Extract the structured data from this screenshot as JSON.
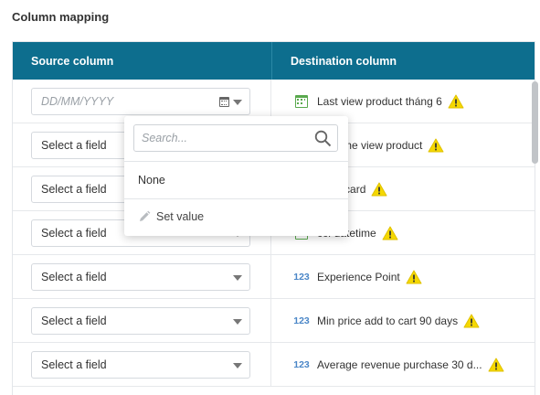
{
  "section_title": "Column mapping",
  "table": {
    "headers": {
      "source": "Source column",
      "destination": "Destination column"
    },
    "rows": [
      {
        "source_value": "DD/MM/YYYY",
        "source_kind": "date",
        "dest_type": "date",
        "dest_label": "Last view product tháng 6",
        "warning": true
      },
      {
        "source_value": "Select a field",
        "source_kind": "select",
        "dest_type": "date",
        "dest_label": "last time view product",
        "warning": true
      },
      {
        "source_value": "Select a field",
        "source_kind": "select",
        "dest_type": "date",
        "dest_label": "dd to card",
        "warning": true
      },
      {
        "source_value": "Select a field",
        "source_kind": "select",
        "dest_type": "date",
        "dest_label": "ccf datetime",
        "warning": true
      },
      {
        "source_value": "Select a field",
        "source_kind": "select",
        "dest_type": "number",
        "dest_label": "Experience Point",
        "warning": true
      },
      {
        "source_value": "Select a field",
        "source_kind": "select",
        "dest_type": "number",
        "dest_label": "Min price add to cart 90 days",
        "warning": true
      },
      {
        "source_value": "Select a field",
        "source_kind": "select",
        "dest_type": "number",
        "dest_label": "Average revenue purchase 30 d...",
        "warning": true
      }
    ],
    "number_type_label": "123"
  },
  "dropdown": {
    "search_placeholder": "Search...",
    "items": [
      {
        "label": "None"
      },
      {
        "label": "Set value"
      }
    ]
  },
  "colors": {
    "header_bg": "#0d6e8e",
    "warning": "#f5d800",
    "date_icon": "#5aa94e",
    "number_icon": "#4a86c7"
  }
}
